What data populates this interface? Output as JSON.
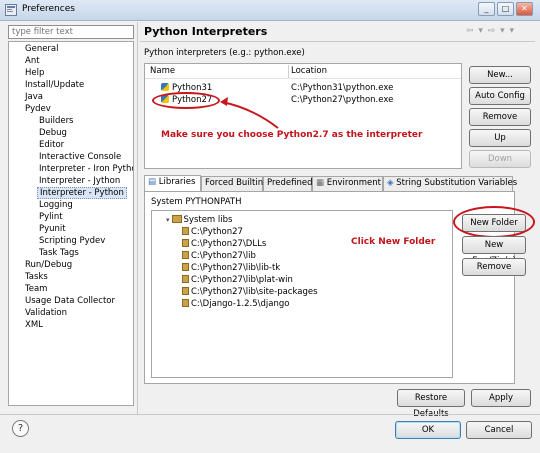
{
  "window": {
    "title": "Preferences",
    "btn_min": "_",
    "btn_max": "□",
    "btn_close": "✕"
  },
  "sidebar": {
    "filter_placeholder": "type filter text",
    "items": [
      {
        "label": "General",
        "level": 0
      },
      {
        "label": "Ant",
        "level": 0
      },
      {
        "label": "Help",
        "level": 0
      },
      {
        "label": "Install/Update",
        "level": 0
      },
      {
        "label": "Java",
        "level": 0
      },
      {
        "label": "Pydev",
        "level": 0
      },
      {
        "label": "Builders",
        "level": 1
      },
      {
        "label": "Debug",
        "level": 1
      },
      {
        "label": "Editor",
        "level": 1
      },
      {
        "label": "Interactive Console",
        "level": 1
      },
      {
        "label": "Interpreter - Iron Pytho",
        "level": 1
      },
      {
        "label": "Interpreter - Jython",
        "level": 1
      },
      {
        "label": "Interpreter - Python",
        "level": 1,
        "selected": true
      },
      {
        "label": "Logging",
        "level": 1
      },
      {
        "label": "Pylint",
        "level": 1
      },
      {
        "label": "Pyunit",
        "level": 1
      },
      {
        "label": "Scripting Pydev",
        "level": 1
      },
      {
        "label": "Task Tags",
        "level": 1
      },
      {
        "label": "Run/Debug",
        "level": 0
      },
      {
        "label": "Tasks",
        "level": 0
      },
      {
        "label": "Team",
        "level": 0
      },
      {
        "label": "Usage Data Collector",
        "level": 0
      },
      {
        "label": "Validation",
        "level": 0
      },
      {
        "label": "XML",
        "level": 0
      }
    ]
  },
  "main": {
    "title": "Python Interpreters",
    "nav_arrows": "⇦ ▾ ⇨ ▾ ▾",
    "subtitle": "Python interpreters (e.g.: python.exe)",
    "table": {
      "columns": [
        "Name",
        "Location"
      ],
      "rows": [
        {
          "name": "Python31",
          "location": "C:\\Python31\\python.exe"
        },
        {
          "name": "Python27",
          "location": "C:\\Python27\\python.exe"
        }
      ]
    },
    "side_buttons": {
      "new": "New...",
      "auto_config": "Auto Config",
      "remove": "Remove",
      "up": "Up",
      "down": "Down"
    },
    "annotation_interpreter": "Make sure you choose Python2.7  as the interpreter",
    "tabs": [
      "Libraries",
      "Forced Builtins",
      "Predefined",
      "Environment",
      "String Substitution Variables"
    ],
    "panel_label": "System PYTHONPATH",
    "paths": {
      "root": "System libs",
      "items": [
        "C:\\Python27",
        "C:\\Python27\\DLLs",
        "C:\\Python27\\lib",
        "C:\\Python27\\lib\\lib-tk",
        "C:\\Python27\\lib\\plat-win",
        "C:\\Python27\\lib\\site-packages",
        "C:\\Django-1.2.5\\django"
      ]
    },
    "path_buttons": {
      "new_folder": "New Folder",
      "new_egg": "New Egg/Zip(s)",
      "remove": "Remove"
    },
    "annotation_folder": "Click New Folder"
  },
  "footer": {
    "restore_defaults": "Restore Defaults",
    "apply": "Apply",
    "ok": "OK",
    "cancel": "Cancel",
    "help": "?"
  }
}
